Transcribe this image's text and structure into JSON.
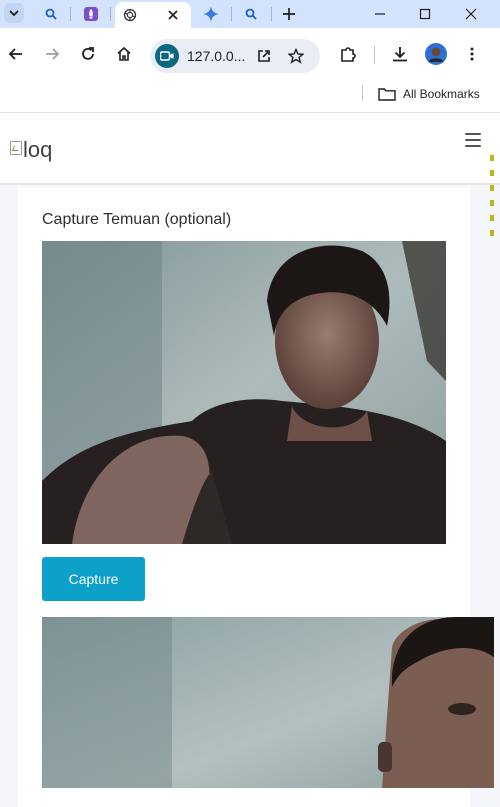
{
  "browser": {
    "tabs": [
      {
        "icon": "search-icon"
      },
      {
        "icon": "rocket-icon"
      },
      {
        "icon": "openai-icon",
        "active": true
      },
      {
        "icon": "sparkle-icon"
      },
      {
        "icon": "search-icon"
      }
    ],
    "new_tab_label": "+",
    "address_text": "127.0.0...",
    "bookmarks": {
      "all_bookmarks_label": "All Bookmarks"
    }
  },
  "site": {
    "logo_alt": "loq"
  },
  "form": {
    "capture_label": "Capture Temuan (optional)",
    "capture_button": "Capture"
  },
  "colors": {
    "accent": "#0da0c8",
    "tabstrip": "#d3e3fd"
  }
}
